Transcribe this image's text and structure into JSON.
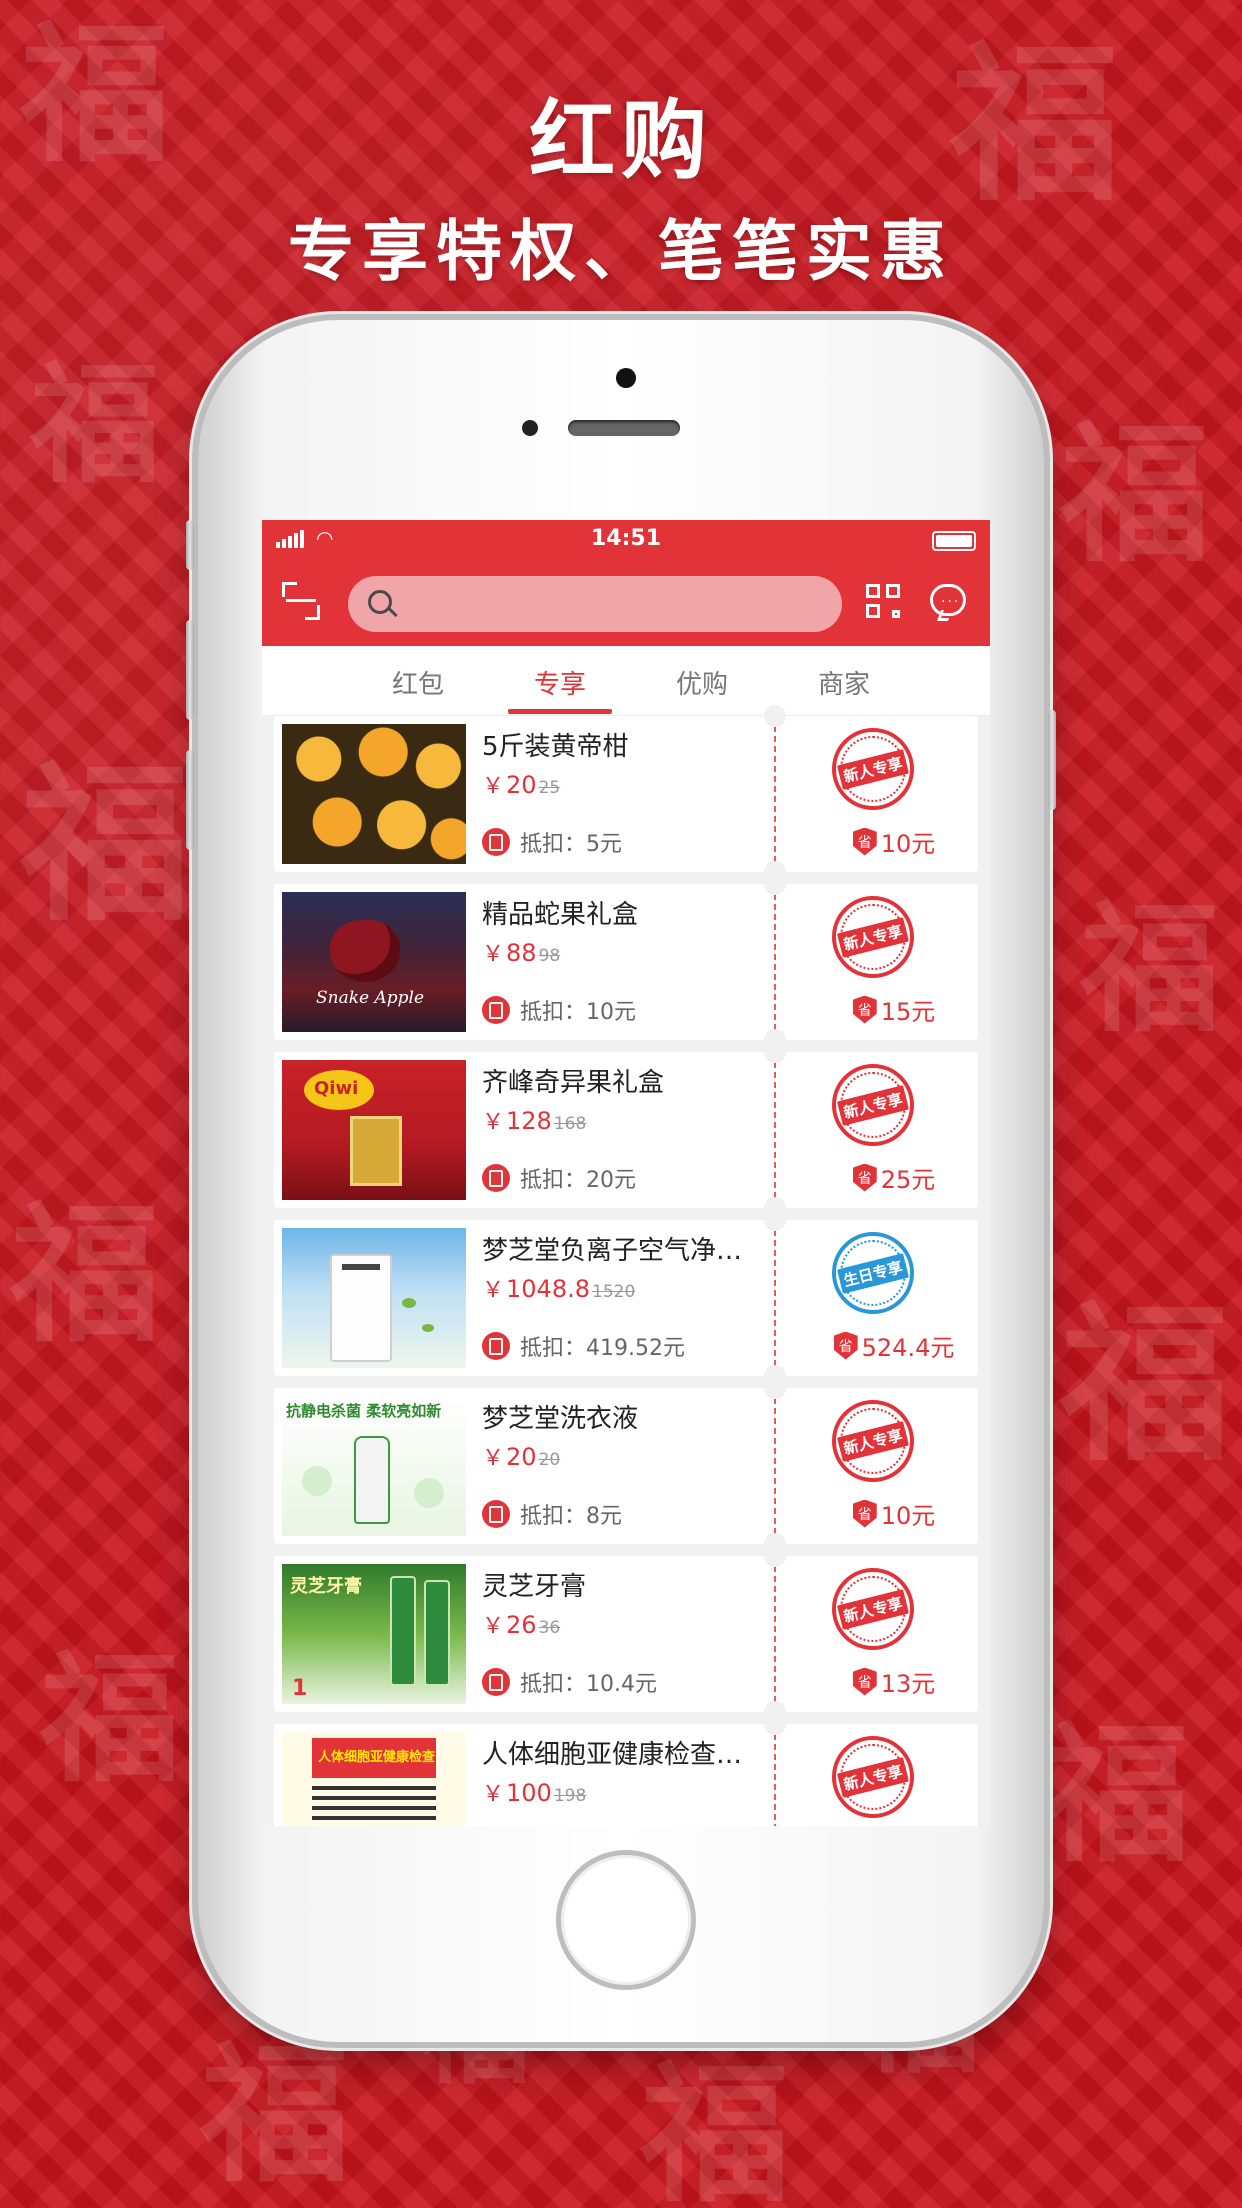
{
  "promo": {
    "title": "红购",
    "subtitle": "专享特权、笔笔实惠"
  },
  "status_bar": {
    "time": "14:51"
  },
  "search": {
    "placeholder": "",
    "value": ""
  },
  "tabs": [
    {
      "label": "红包",
      "active": false
    },
    {
      "label": "专享",
      "active": true
    },
    {
      "label": "优购",
      "active": false
    },
    {
      "label": "商家",
      "active": false
    }
  ],
  "colors": {
    "brand_red": "#e23339",
    "birthday_blue": "#2a98d8"
  },
  "products": [
    {
      "title": "5斤装黄帝柑",
      "currency": "￥",
      "price": "20",
      "original_price": "25",
      "deduct_label": "抵扣：",
      "deduct_value": "5元",
      "stamp": "新人专享",
      "save_icon": "省",
      "save": "10元",
      "thumb_icon": "orange-fruit-icon"
    },
    {
      "title": "精品蛇果礼盒",
      "currency": "￥",
      "price": "88",
      "original_price": "98",
      "deduct_label": "抵扣：",
      "deduct_value": "10元",
      "stamp": "新人专享",
      "save_icon": "省",
      "save": "15元",
      "thumb_icon": "apple-giftbox-icon",
      "thumb_text": "Snake Apple"
    },
    {
      "title": "齐峰奇异果礼盒",
      "currency": "￥",
      "price": "128",
      "original_price": "168",
      "deduct_label": "抵扣：",
      "deduct_value": "20元",
      "stamp": "新人专享",
      "save_icon": "省",
      "save": "25元",
      "thumb_icon": "kiwi-giftbag-icon",
      "thumb_text": "Qiwi"
    },
    {
      "title": "梦芝堂负离子空气净化器",
      "currency": "￥",
      "price": "1048.8",
      "original_price": "1520",
      "deduct_label": "抵扣：",
      "deduct_value": "419.52元",
      "stamp": "生日专享",
      "save_icon": "省",
      "save": "524.4元",
      "thumb_icon": "air-purifier-icon"
    },
    {
      "title": "梦芝堂洗衣液",
      "currency": "￥",
      "price": "20",
      "original_price": "20",
      "deduct_label": "抵扣：",
      "deduct_value": "8元",
      "stamp": "新人专享",
      "save_icon": "省",
      "save": "10元",
      "thumb_icon": "laundry-detergent-icon",
      "thumb_text": "抗静电杀菌 柔软亮如新"
    },
    {
      "title": "灵芝牙膏",
      "currency": "￥",
      "price": "26",
      "original_price": "36",
      "deduct_label": "抵扣：",
      "deduct_value": "10.4元",
      "stamp": "新人专享",
      "save_icon": "省",
      "save": "13元",
      "thumb_icon": "toothpaste-icon",
      "thumb_text": "灵芝牙膏"
    },
    {
      "title": "人体细胞亚健康检查…",
      "currency": "￥",
      "price": "100",
      "original_price": "198",
      "deduct_label": "抵扣：",
      "deduct_value": "",
      "stamp": "新人专享",
      "save_icon": "省",
      "save": "",
      "thumb_icon": "health-check-flyer-icon",
      "thumb_text": "人体细胞亚健康检查"
    }
  ]
}
